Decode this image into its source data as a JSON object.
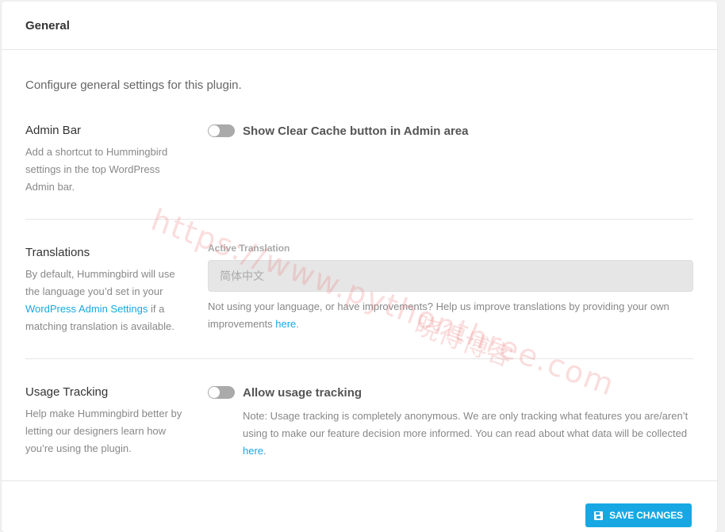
{
  "header": {
    "title": "General"
  },
  "intro": "Configure general settings for this plugin.",
  "admin_bar": {
    "title": "Admin Bar",
    "desc": "Add a shortcut to Hummingbird settings in the top WordPress Admin bar.",
    "toggle_label": "Show Clear Cache button in Admin area",
    "toggle_on": false
  },
  "translations": {
    "title": "Translations",
    "desc_before": "By default, Hummingbird will use the language you’d set in your ",
    "desc_link": "WordPress Admin Settings",
    "desc_after": " if a matching translation is available.",
    "field_label": "Active Translation",
    "select_value": "简体中文",
    "note_before": "Not using your language, or have improvements? Help us improve translations by providing your own improvements ",
    "note_link": "here",
    "note_after": "."
  },
  "usage_tracking": {
    "title": "Usage Tracking",
    "desc": "Help make Hummingbird better by letting our designers learn how you’re using the plugin.",
    "toggle_label": "Allow usage tracking",
    "toggle_on": false,
    "note_before": "Note: Usage tracking is completely anonymous. We are only tracking what features you are/aren’t using to make our feature decision more informed. You can read about what data will be collected ",
    "note_link": "here",
    "note_after": "."
  },
  "footer": {
    "save_label": "SAVE CHANGES"
  },
  "watermark": {
    "line1": "https://www.pythonthree.com",
    "line2": "晓得博客"
  },
  "colors": {
    "accent": "#17a8e3",
    "toggle_off": "#aaaaaa"
  }
}
